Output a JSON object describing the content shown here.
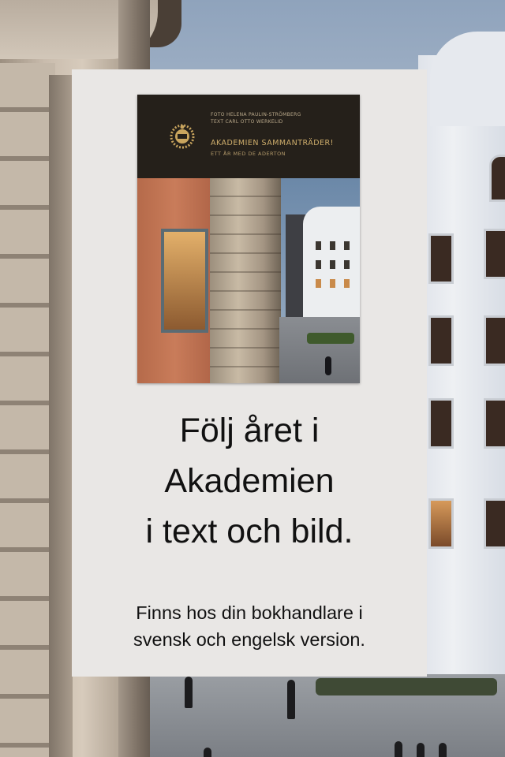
{
  "cover": {
    "credit_photo": "FOTO HELENA PAULIN-STRÖMBERG",
    "credit_text": "TEXT CARL OTTO WERKELID",
    "title": "AKADEMIEN SAMMANTRÄDER!",
    "subtitle": "ETT ÅR MED DE ADERTON"
  },
  "headline": {
    "line1": "Följ året i",
    "line2": "Akademien",
    "line3": "i text och bild."
  },
  "subline": {
    "line1": "Finns hos din bokhandlare i",
    "line2": "svensk och engelsk version."
  },
  "colors": {
    "card_background": "#e9e7e5",
    "cover_dark": "#25201a",
    "cover_gold": "#cfae6c"
  },
  "icons": {
    "emblem": "laurel-wreath-emblem"
  }
}
